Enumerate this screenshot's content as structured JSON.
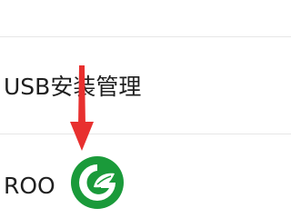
{
  "settings_list": {
    "items": [
      {
        "label": "USB安装管理"
      },
      {
        "label": "ROO"
      }
    ]
  },
  "annotation": {
    "arrow_color": "#e8302f"
  },
  "watermark": {
    "logo": "green-leaf-g-logo",
    "color": "#1a9a3a"
  }
}
